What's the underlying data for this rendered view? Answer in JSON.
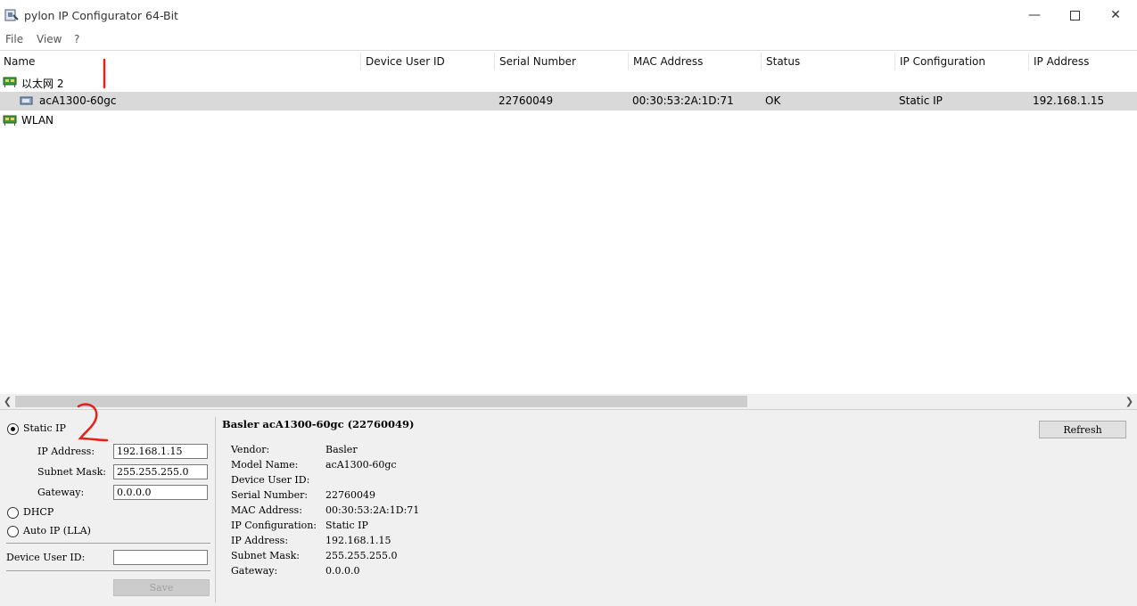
{
  "window": {
    "title": "pylon IP Configurator 64-Bit"
  },
  "menu": [
    "File",
    "View",
    "?"
  ],
  "columns": [
    "Name",
    "Device User ID",
    "Serial Number",
    "MAC Address",
    "Status",
    "IP Configuration",
    "IP Address"
  ],
  "tree": {
    "adapter1": {
      "name": "以太网 2"
    },
    "device": {
      "name": "acA1300-60gc",
      "user_id": "",
      "serial": "22760049",
      "mac": "00:30:53:2A:1D:71",
      "status": "OK",
      "ip_config": "Static IP",
      "ip": "192.168.1.15"
    },
    "adapter2": {
      "name": "WLAN"
    }
  },
  "config": {
    "static_ip_label": "Static IP",
    "static_ip_selected": true,
    "ip_label": "IP Address:",
    "ip_value": "192.168.1.15",
    "subnet_label": "Subnet Mask:",
    "subnet_value": "255.255.255.0",
    "gateway_label": "Gateway:",
    "gateway_value": "0.0.0.0",
    "dhcp_label": "DHCP",
    "autoip_label": "Auto IP (LLA)",
    "userid_label": "Device User ID:",
    "userid_value": "",
    "save_label": "Save"
  },
  "details": {
    "title": "Basler acA1300-60gc (22760049)",
    "rows": [
      {
        "label": "Vendor:",
        "value": "Basler"
      },
      {
        "label": "Model Name:",
        "value": "acA1300-60gc"
      },
      {
        "label": "Device User ID:",
        "value": ""
      },
      {
        "label": "Serial Number:",
        "value": "22760049"
      },
      {
        "label": "MAC Address:",
        "value": "00:30:53:2A:1D:71"
      },
      {
        "label": "IP Configuration:",
        "value": "Static IP"
      },
      {
        "label": "IP Address:",
        "value": "192.168.1.15"
      },
      {
        "label": "Subnet Mask:",
        "value": "255.255.255.0"
      },
      {
        "label": "Gateway:",
        "value": "0.0.0.0"
      }
    ],
    "refresh_label": "Refresh"
  },
  "annotations": [
    "1",
    "2"
  ],
  "colors": {
    "selection": "#d9d9d9",
    "panel": "#f0f0f0",
    "annotation": "#e8201a"
  }
}
